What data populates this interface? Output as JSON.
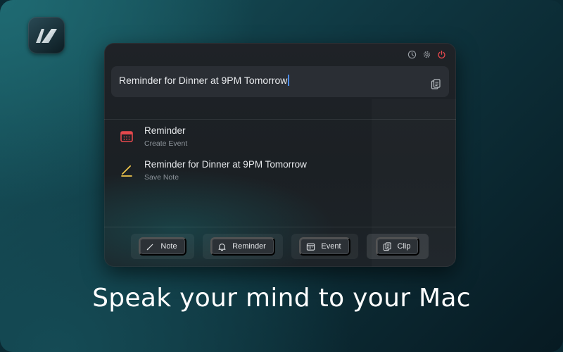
{
  "app": {
    "logo_icon": "app-logo-icon"
  },
  "window": {
    "titlebar_icons": [
      "history-icon",
      "gear-icon",
      "power-icon"
    ],
    "accent_power": "#e5484d",
    "input": {
      "value": "Reminder for Dinner at 9PM Tomorrow",
      "clipboard_icon": "clipboard-icon"
    },
    "results": [
      {
        "title": "Reminder",
        "subtitle": "Create Event",
        "icon": "calendar-icon",
        "icon_color": "#e5484d"
      },
      {
        "title": "Reminder for Dinner at 9PM Tomorrow",
        "subtitle": "Save Note",
        "icon": "pencil-icon",
        "icon_color": "#f2c94c"
      }
    ],
    "actions": [
      {
        "label": "Note",
        "icon": "pencil-icon"
      },
      {
        "label": "Reminder",
        "icon": "bell-icon"
      },
      {
        "label": "Event",
        "icon": "calendar-icon"
      },
      {
        "label": "Clip",
        "icon": "clipboard-icon"
      }
    ]
  },
  "tagline": "Speak your mind to your Mac"
}
